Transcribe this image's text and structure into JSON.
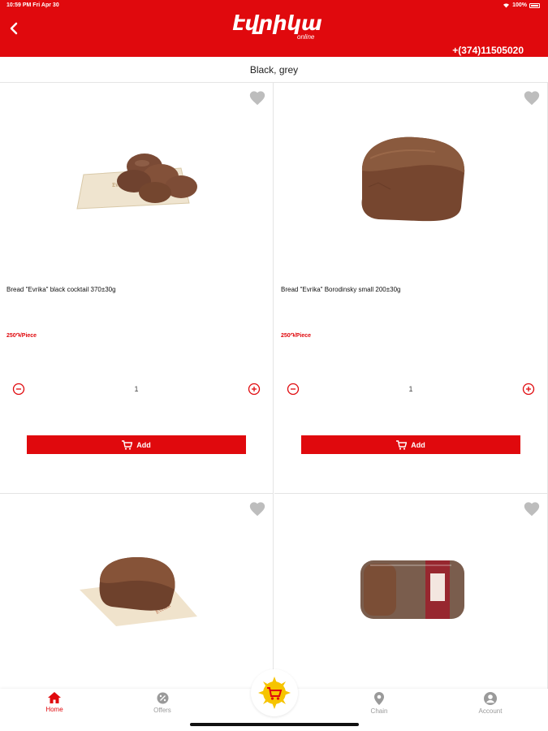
{
  "status": {
    "time": "10:59 PM  Fri Apr 30",
    "battery": "100%"
  },
  "header": {
    "logo_main": "էվրիկա",
    "logo_sub": "online",
    "phone": "+(374)11505020"
  },
  "category": {
    "title": "Black, grey"
  },
  "products": [
    {
      "name": "Bread \"Evrika\" black cocktail 370±30g",
      "price": "250֏/Piece",
      "qty": "1",
      "add_label": "Add"
    },
    {
      "name": "Bread \"Evrika\" Borodinsky small 200±30g",
      "price": "250֏/Piece",
      "qty": "1",
      "add_label": "Add"
    }
  ],
  "nav": {
    "home": "Home",
    "offers": "Offers",
    "chain": "Chain",
    "account": "Account"
  },
  "colors": {
    "brand_red": "#e0090d",
    "nav_grey": "#9a9a9a"
  },
  "icons": [
    "chevron-left-icon",
    "heart-icon",
    "minus-circle-icon",
    "plus-circle-icon",
    "cart-icon",
    "home-icon",
    "percent-icon",
    "location-pin-icon",
    "user-icon",
    "sun-cart-icon"
  ]
}
